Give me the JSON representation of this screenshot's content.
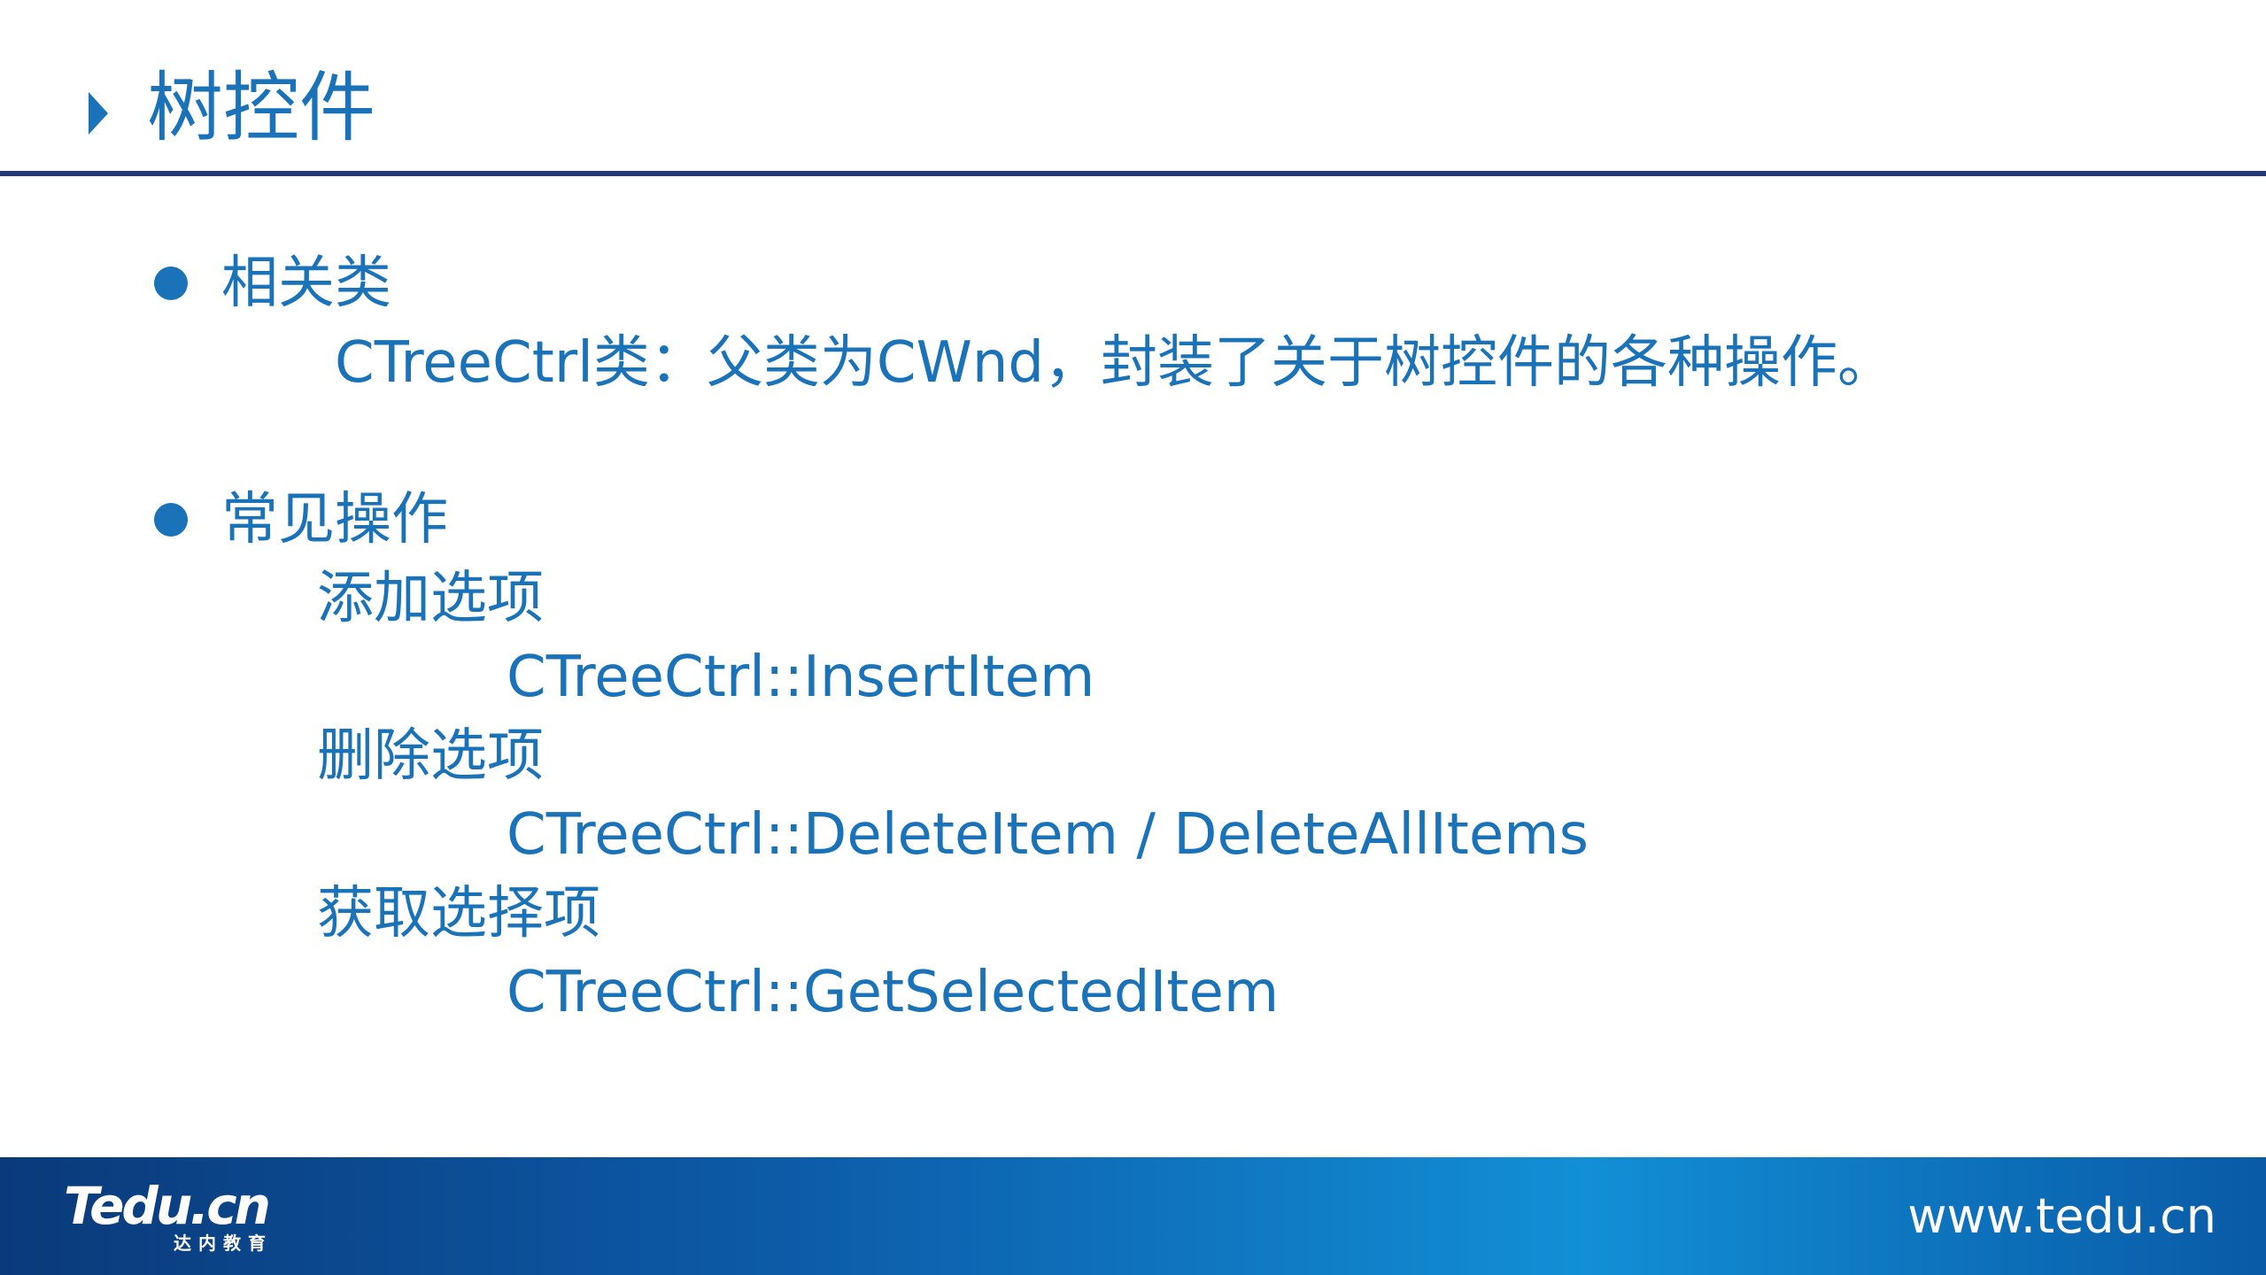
{
  "slide": {
    "title": "树控件",
    "sections": [
      {
        "heading": "相关类",
        "lines": [
          "CTreeCtrl类：父类为CWnd，封装了关于树控件的各种操作。"
        ]
      },
      {
        "heading": "常见操作",
        "operations": [
          {
            "name": "添加选项",
            "method": "CTreeCtrl::InsertItem"
          },
          {
            "name": "删除选项",
            "method": "CTreeCtrl::DeleteItem / DeleteAllItems"
          },
          {
            "name": "获取选择项",
            "method": "CTreeCtrl::GetSelectedItem"
          }
        ]
      }
    ]
  },
  "footer": {
    "logo_text": "Tedu.cn",
    "logo_subtitle": "达内教育",
    "url": "www.tedu.cn"
  },
  "colors": {
    "text_blue": "#1a73b9",
    "rule_navy": "#253a78",
    "footer_start": "#0a3a7a",
    "footer_mid": "#128fd6"
  }
}
